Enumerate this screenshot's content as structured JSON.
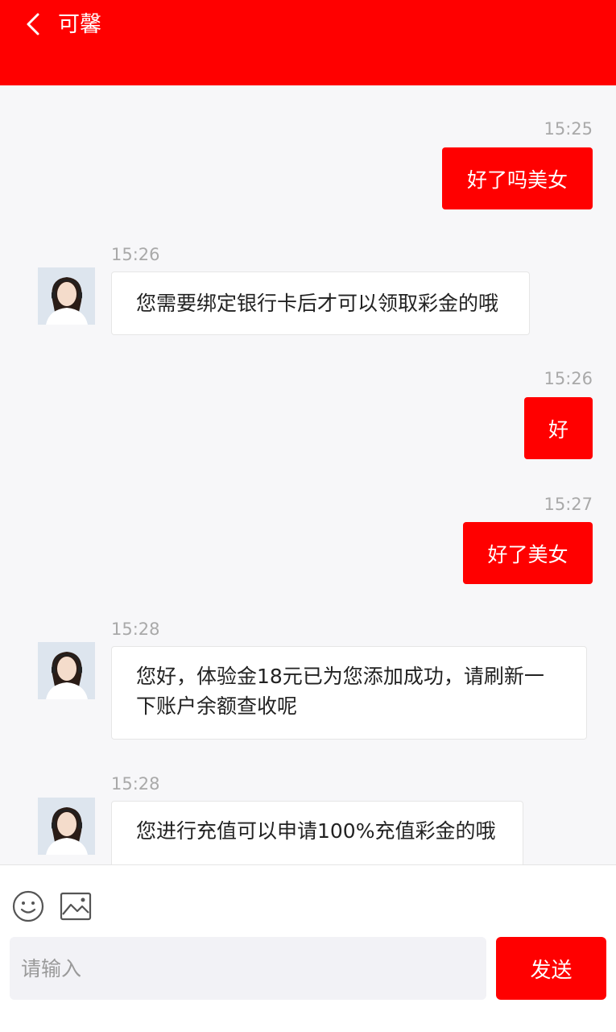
{
  "header": {
    "title": "可馨",
    "back_icon": "chevron-left-icon",
    "background": "#ff0000"
  },
  "messages": [
    {
      "side": "out",
      "time": "15:25",
      "text": "好了吗美女"
    },
    {
      "side": "in",
      "time": "15:26",
      "text": "您需要绑定银行卡后才可以领取彩金的哦"
    },
    {
      "side": "out",
      "time": "15:26",
      "text": "好"
    },
    {
      "side": "out",
      "time": "15:27",
      "text": "好了美女"
    },
    {
      "side": "in",
      "time": "15:28",
      "text": "您好，体验金18元已为您添加成功，请刷新一下账户余额查收呢"
    },
    {
      "side": "in",
      "time": "15:28",
      "text": "您进行充值可以申请100%充值彩金的哦"
    }
  ],
  "toolbar": {
    "emoji_icon": "smiley-icon",
    "image_icon": "image-icon",
    "input_placeholder": "请输入",
    "input_value": "",
    "send_label": "发送"
  },
  "colors": {
    "accent": "#ff0000",
    "background": "#f7f7f9"
  }
}
